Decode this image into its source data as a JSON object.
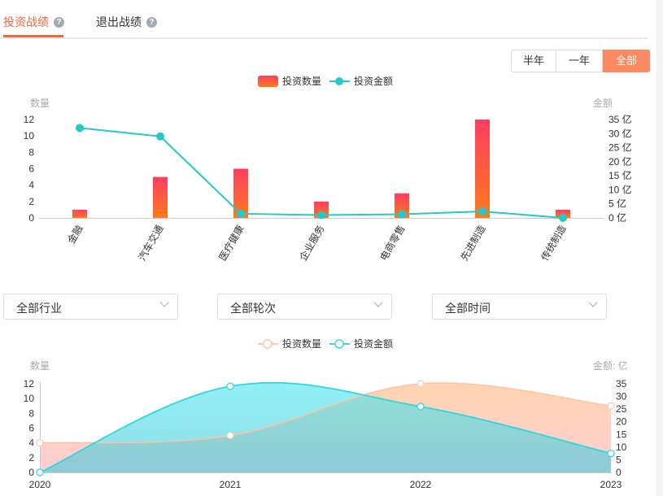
{
  "tabs": [
    {
      "label": "投资战绩",
      "active": true
    },
    {
      "label": "退出战绩",
      "active": false
    }
  ],
  "help_glyph": "?",
  "period_buttons": [
    {
      "label": "半年"
    },
    {
      "label": "一年"
    },
    {
      "label": "全部",
      "active": true
    }
  ],
  "chart1_legend": {
    "bar": "投资数量",
    "line": "投资金额"
  },
  "filters": [
    {
      "label": "全部行业"
    },
    {
      "label": "全部轮次"
    },
    {
      "label": "全部时间"
    }
  ],
  "chart2_legend": {
    "count": "投资数量",
    "amount": "投资金额"
  },
  "colors": {
    "accent": "#f0663f",
    "bar_top": "#ff3d62",
    "bar_bottom": "#ff7a1a",
    "line_teal": "#27c8c8",
    "area_cyan": "#5ae6ee",
    "area_peach": "#ffd1b3"
  },
  "chart_data": [
    {
      "type": "bar",
      "left_axis_label": "数量",
      "right_axis_label": "金额",
      "categories": [
        "金融",
        "汽车交通",
        "医疗健康",
        "企业服务",
        "电商零售",
        "先进制造",
        "传统制造"
      ],
      "left_ticks": [
        "0",
        "2",
        "4",
        "6",
        "8",
        "10",
        "12"
      ],
      "right_ticks": [
        "0 亿",
        "5 亿",
        "10 亿",
        "15 亿",
        "20 亿",
        "25 亿",
        "30 亿",
        "35 亿"
      ],
      "ylim_left": [
        0,
        12
      ],
      "ylim_right": [
        0,
        35
      ],
      "series": [
        {
          "name": "投资数量",
          "type": "bar",
          "axis": "left",
          "values": [
            1,
            5,
            6,
            2,
            3,
            12,
            1
          ]
        },
        {
          "name": "投资金额",
          "type": "line",
          "axis": "right",
          "values": [
            32,
            29,
            1.5,
            1,
            1.3,
            2.3,
            0
          ]
        }
      ]
    },
    {
      "type": "area",
      "left_axis_label": "数量",
      "right_axis_label": "金额: 亿",
      "x": [
        "2020",
        "2021",
        "2022",
        "2023"
      ],
      "left_ticks": [
        "0",
        "2",
        "4",
        "6",
        "8",
        "10",
        "12"
      ],
      "right_ticks": [
        "0",
        "5",
        "10",
        "15",
        "20",
        "25",
        "30",
        "35"
      ],
      "ylim_left": [
        0,
        12
      ],
      "ylim_right": [
        0,
        35
      ],
      "series": [
        {
          "name": "投资数量",
          "axis": "left",
          "values": [
            4,
            5,
            12,
            9
          ]
        },
        {
          "name": "投资金额",
          "axis": "right",
          "values": [
            0,
            34,
            26,
            7.5
          ]
        }
      ]
    }
  ]
}
